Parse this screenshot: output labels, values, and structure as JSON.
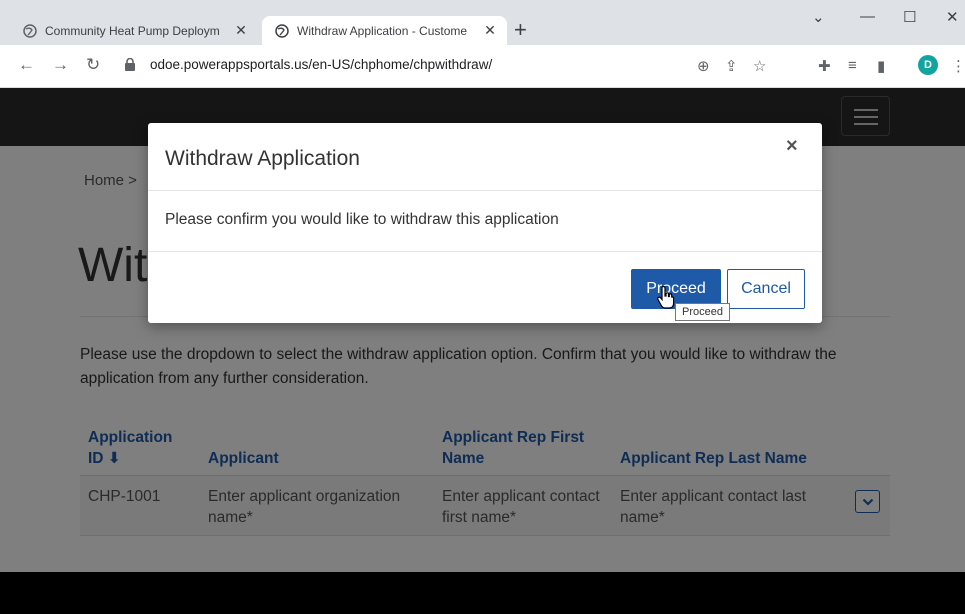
{
  "browser": {
    "tabs": [
      {
        "title": "Community Heat Pump Deploym",
        "active": false
      },
      {
        "title": "Withdraw Application - Custome",
        "active": true
      }
    ],
    "new_tab": "+",
    "window_controls": {
      "dropdown": "⌄",
      "minimize": "—",
      "maximize": "☐",
      "close": "✕"
    },
    "url": "odoe.powerappsportals.us/en-US/chphome/chpwithdraw/",
    "profile_initial": "D",
    "profile_color": "#12a4a0"
  },
  "page": {
    "breadcrumb": "Home >",
    "title": "Withdraw Application",
    "instructions": "Please use the dropdown to select the withdraw application option.  Confirm that you would like to withdraw the application from any further consideration.",
    "table": {
      "headers": [
        "Application ID ⬇",
        "Applicant",
        "Applicant Rep First Name",
        "Applicant Rep Last Name"
      ],
      "rows": [
        [
          "CHP-1001",
          "Enter applicant organization name*",
          "Enter applicant contact first name*",
          "Enter applicant contact last name*"
        ]
      ]
    }
  },
  "modal": {
    "title": "Withdraw Application",
    "close": "×",
    "body": "Please confirm you would like to withdraw this application",
    "proceed": "Proceed",
    "cancel": "Cancel",
    "tooltip": "Proceed"
  },
  "colors": {
    "accent": "#1f5aa8",
    "header": "#2a2a2a"
  }
}
